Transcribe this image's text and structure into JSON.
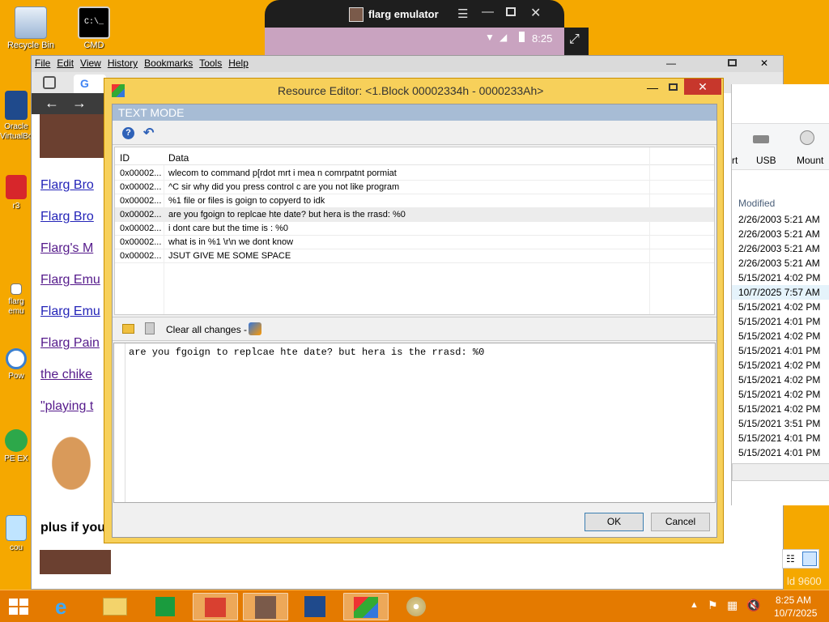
{
  "desktop": {
    "icons": [
      {
        "label": "Recycle Bin",
        "icon": "recycle-bin-icon"
      },
      {
        "label": "CMD",
        "icon": "cmd-icon"
      },
      {
        "label": "Oracle VirtualBox",
        "icon": "virtualbox-icon"
      },
      {
        "label": "r3",
        "icon": "app-icon"
      },
      {
        "label": "flarg emu",
        "icon": "shortcut-icon"
      },
      {
        "label": "Pow",
        "icon": "powershell-icon"
      },
      {
        "label": "PE EX",
        "icon": "pe-explorer-icon"
      },
      {
        "label": "cou",
        "icon": "computer-icon"
      }
    ]
  },
  "emulator": {
    "title": "flarg emulator",
    "time": "8:25"
  },
  "browser": {
    "menu": [
      "File",
      "Edit",
      "View",
      "History",
      "Bookmarks",
      "Tools",
      "Help"
    ],
    "links": [
      {
        "text": "Flarg Bro",
        "visited": false
      },
      {
        "text": "Flarg Bro",
        "visited": false
      },
      {
        "text": "Flarg's M",
        "visited": true
      },
      {
        "text": "Flarg Emu",
        "visited": true
      },
      {
        "text": "Flarg Emu",
        "visited": false
      },
      {
        "text": "Flarg Pain",
        "visited": true
      },
      {
        "text": "the chike",
        "visited": true
      },
      {
        "text": "\"playing t",
        "visited": true
      }
    ],
    "plus_text": "plus if you"
  },
  "explorer": {
    "ribbon": {
      "partial_label": "rt",
      "usb_label": "USB",
      "mount_label": "Mount"
    },
    "column_header": "Modified",
    "dates": [
      "2/26/2003 5:21 AM",
      "2/26/2003 5:21 AM",
      "2/26/2003 5:21 AM",
      "2/26/2003 5:21 AM",
      "5/15/2021 4:02 PM",
      "10/7/2025 7:57 AM",
      "5/15/2021 4:02 PM",
      "5/15/2021 4:01 PM",
      "5/15/2021 4:02 PM",
      "5/15/2021 4:01 PM",
      "5/15/2021 4:02 PM",
      "5/15/2021 4:02 PM",
      "5/15/2021 4:02 PM",
      "5/15/2021 4:02 PM",
      "5/15/2021 3:51 PM",
      "5/15/2021 4:01 PM",
      "5/15/2021 4:01 PM"
    ],
    "highlight_index": 5,
    "build": "ld 9600"
  },
  "dialog": {
    "title": "Resource Editor: <1.Block 00002334h - 0000233Ah>",
    "mode_label": "TEXT MODE",
    "columns": {
      "id": "ID",
      "data": "Data"
    },
    "rows": [
      {
        "id": "0x00002...",
        "data": "wlecom to command p[rdot mrt i mea n comrpatnt pormiat"
      },
      {
        "id": "0x00002...",
        "data": "^C sir why did you press control c are you not like program"
      },
      {
        "id": "0x00002...",
        "data": "%1 file or files is goign to copyerd to idk"
      },
      {
        "id": "0x00002...",
        "data": "are you fgoign to replcae hte date? but hera is the rrasd: %0"
      },
      {
        "id": "0x00002...",
        "data": "i dont care but the time is : %0"
      },
      {
        "id": "0x00002...",
        "data": " what is in  %1 \\r\\n we dont know"
      },
      {
        "id": "0x00002...",
        "data": "JSUT GIVE ME SOME SPACE"
      }
    ],
    "selected_row": 3,
    "clear_label": "Clear all changes -",
    "editor_text": "are you fgoign to replcae hte date? but hera is the rrasd: %0",
    "ok_label": "OK",
    "cancel_label": "Cancel"
  },
  "taskbar": {
    "time": "8:25 AM",
    "date": "10/7/2025",
    "apps": [
      "file-explorer-icon",
      "internet-explorer-icon",
      "folder-icon",
      "store-icon",
      "pe-app-icon",
      "flarg-app-icon",
      "virtualbox-icon",
      "resource-hacker-icon",
      "disc-icon"
    ]
  },
  "colors": {
    "desktop": "#f5a800",
    "taskbar": "#e47a00",
    "dialog_frame": "#f7d05a",
    "close_red": "#c7372c",
    "mode_bar": "#a7bcd5"
  }
}
